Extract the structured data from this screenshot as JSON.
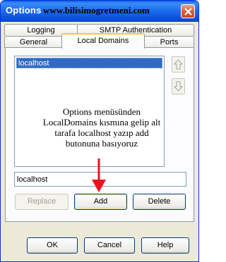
{
  "window": {
    "title": "Options",
    "watermark": "www.bilisimogretmeni.com",
    "close_icon": "close-icon"
  },
  "tabs": {
    "row1": [
      {
        "label": "Logging"
      },
      {
        "label": "SMTP Authentication"
      }
    ],
    "row2": [
      {
        "label": "General"
      },
      {
        "label": "Local Domains",
        "active": true
      },
      {
        "label": "Ports"
      }
    ]
  },
  "domains": {
    "items": [
      {
        "label": "localhost",
        "selected": true
      }
    ],
    "move_up_icon": "arrow-up-icon",
    "move_down_icon": "arrow-down-icon"
  },
  "annotation": {
    "lines": [
      "Options menüsünden",
      "LocalDomains kısmına gelip alt",
      "tarafa localhost yazıp add",
      "butonuna basıyoruz"
    ],
    "arrow_color": "#e8141b"
  },
  "input": {
    "value": "localhost"
  },
  "actions": {
    "replace_label": "Replace",
    "add_label": "Add",
    "delete_label": "Delete"
  },
  "footer": {
    "ok_label": "OK",
    "cancel_label": "Cancel",
    "help_label": "Help"
  },
  "colors": {
    "titlebar": "#0a5fe8",
    "selection": "#316ac5",
    "dialog_bg": "#ece9d8"
  }
}
